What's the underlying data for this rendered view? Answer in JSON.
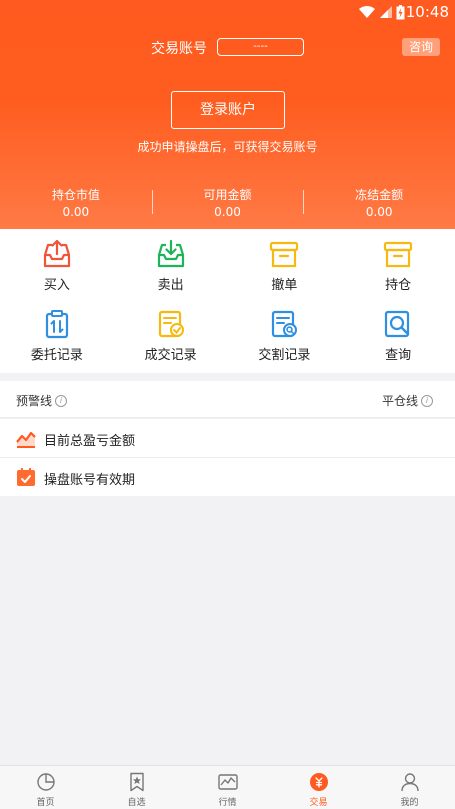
{
  "status_bar": {
    "time": "10:48"
  },
  "header": {
    "account_label": "交易账号",
    "account_value": "----",
    "consult_label": "咨询",
    "login_button": "登录账户",
    "login_hint": "成功申请操盘后，可获得交易账号"
  },
  "stats": [
    {
      "label": "持仓市值",
      "value": "0.00"
    },
    {
      "label": "可用金额",
      "value": "0.00"
    },
    {
      "label": "冻结金额",
      "value": "0.00"
    }
  ],
  "actions": [
    {
      "label": "买入",
      "icon": "buy-tray-icon",
      "color": "#f0553a"
    },
    {
      "label": "卖出",
      "icon": "sell-tray-icon",
      "color": "#1fb35a"
    },
    {
      "label": "撤单",
      "icon": "cancel-box-icon",
      "color": "#f5b90f"
    },
    {
      "label": "持仓",
      "icon": "position-box-icon",
      "color": "#f5b90f"
    },
    {
      "label": "委托记录",
      "icon": "order-record-icon",
      "color": "#2f8fe0"
    },
    {
      "label": "成交记录",
      "icon": "deal-record-icon",
      "color": "#f5b90f"
    },
    {
      "label": "交割记录",
      "icon": "delivery-record-icon",
      "color": "#2f8fe0"
    },
    {
      "label": "查询",
      "icon": "query-search-icon",
      "color": "#2f8fe0"
    }
  ],
  "lines": {
    "warning_label": "预警线",
    "liquidation_label": "平仓线"
  },
  "list": [
    {
      "label": "目前总盈亏金额",
      "icon": "profit-trend-icon"
    },
    {
      "label": "操盘账号有效期",
      "icon": "calendar-check-icon"
    }
  ],
  "tabs": [
    {
      "label": "首页",
      "icon": "pie-chart-icon"
    },
    {
      "label": "自选",
      "icon": "bookmark-star-icon"
    },
    {
      "label": "行情",
      "icon": "market-chart-icon"
    },
    {
      "label": "交易",
      "icon": "trade-coin-icon",
      "active": true
    },
    {
      "label": "我的",
      "icon": "user-icon"
    }
  ],
  "colors": {
    "primary": "#ff5a1f",
    "accent_orange": "#ff7a45"
  }
}
